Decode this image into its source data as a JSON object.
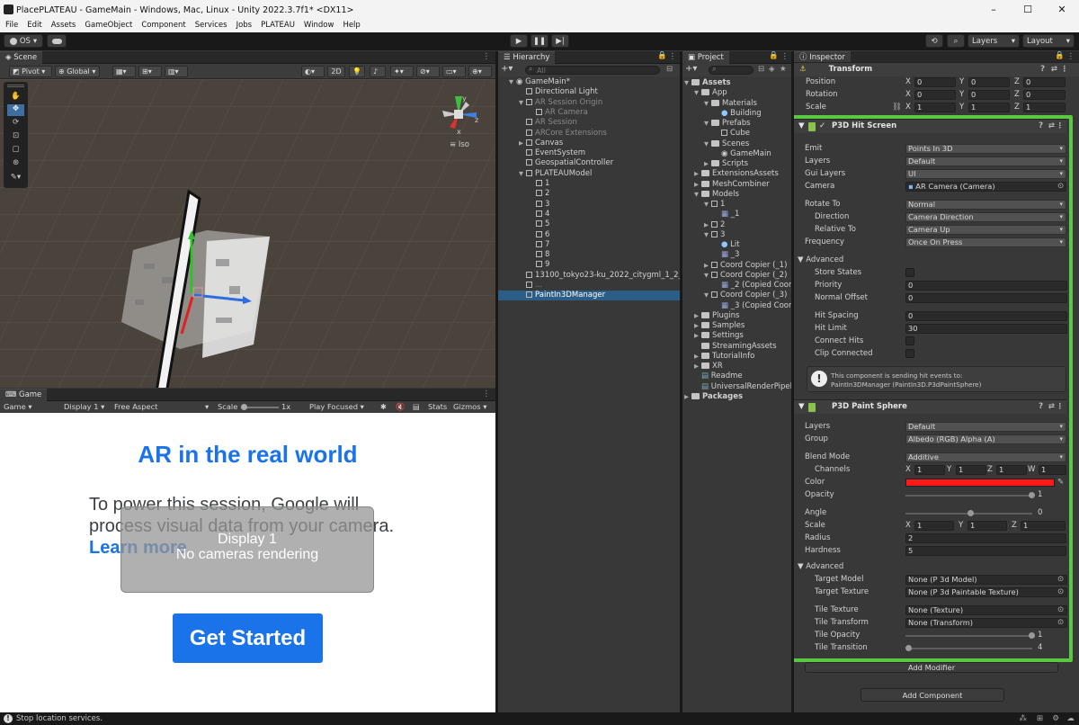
{
  "window": {
    "title": "PlacePLATEAU - GameMain - Windows, Mac, Linux - Unity 2022.3.7f1* <DX11>",
    "controls": [
      "–",
      "☐",
      "✕"
    ]
  },
  "menu": [
    "File",
    "Edit",
    "Assets",
    "GameObject",
    "Component",
    "Services",
    "Jobs",
    "PLATEAU",
    "Window",
    "Help"
  ],
  "toolbar": {
    "account": "OS",
    "layers": "Layers",
    "layout": "Layout"
  },
  "scene": {
    "tab": "Scene",
    "pivot": "Pivot",
    "global": "Global",
    "mode2d": "2D",
    "iso": "Iso",
    "gizmo_axes": {
      "x": "x",
      "y": "y",
      "z": "z"
    }
  },
  "game": {
    "tab": "Game",
    "view": "Game",
    "display": "Display 1",
    "aspect": "Free Aspect",
    "scale_label": "Scale",
    "scale_value": "1x",
    "play_focused": "Play Focused",
    "stats": "Stats",
    "gizmos": "Gizmos",
    "heading": "AR in the real world",
    "body": "To power this session, Google will process visual data from your camera.",
    "learn_more": "Learn more",
    "overlay_line1": "Display 1",
    "overlay_line2": "No cameras rendering",
    "button": "Get Started"
  },
  "hierarchy": {
    "tab": "Hierarchy",
    "search_placeholder": "All",
    "items": [
      {
        "label": "GameMain*",
        "indent": 0,
        "kind": "scene",
        "muted": false,
        "arrow": "▼"
      },
      {
        "label": "Directional Light",
        "indent": 1,
        "kind": "cube",
        "muted": false,
        "arrow": ""
      },
      {
        "label": "AR Session Origin",
        "indent": 1,
        "kind": "cube",
        "muted": true,
        "arrow": "▼"
      },
      {
        "label": "AR Camera",
        "indent": 2,
        "kind": "cube",
        "muted": true,
        "arrow": ""
      },
      {
        "label": "AR Session",
        "indent": 1,
        "kind": "cube",
        "muted": true,
        "arrow": ""
      },
      {
        "label": "ARCore Extensions",
        "indent": 1,
        "kind": "cube",
        "muted": true,
        "arrow": ""
      },
      {
        "label": "Canvas",
        "indent": 1,
        "kind": "cube",
        "muted": false,
        "arrow": "▶"
      },
      {
        "label": "EventSystem",
        "indent": 1,
        "kind": "cube",
        "muted": false,
        "arrow": ""
      },
      {
        "label": "GeospatialController",
        "indent": 1,
        "kind": "cube",
        "muted": false,
        "arrow": ""
      },
      {
        "label": "PLATEAUModel",
        "indent": 1,
        "kind": "cube",
        "muted": false,
        "arrow": "▼"
      },
      {
        "label": "1",
        "indent": 2,
        "kind": "cube",
        "muted": false,
        "arrow": ""
      },
      {
        "label": "2",
        "indent": 2,
        "kind": "cube",
        "muted": false,
        "arrow": ""
      },
      {
        "label": "3",
        "indent": 2,
        "kind": "cube",
        "muted": false,
        "arrow": ""
      },
      {
        "label": "4",
        "indent": 2,
        "kind": "cube",
        "muted": false,
        "arrow": ""
      },
      {
        "label": "5",
        "indent": 2,
        "kind": "cube",
        "muted": false,
        "arrow": ""
      },
      {
        "label": "6",
        "indent": 2,
        "kind": "cube",
        "muted": false,
        "arrow": ""
      },
      {
        "label": "7",
        "indent": 2,
        "kind": "cube",
        "muted": false,
        "arrow": ""
      },
      {
        "label": "8",
        "indent": 2,
        "kind": "cube",
        "muted": false,
        "arrow": ""
      },
      {
        "label": "9",
        "indent": 2,
        "kind": "cube",
        "muted": false,
        "arrow": ""
      },
      {
        "label": "13100_tokyo23-ku_2022_citygml_1_2_...",
        "indent": 1,
        "kind": "cube",
        "muted": false,
        "arrow": ""
      },
      {
        "label": "...",
        "indent": 1,
        "kind": "cube",
        "muted": true,
        "arrow": ""
      },
      {
        "label": "PaintIn3DManager",
        "indent": 1,
        "kind": "cube",
        "muted": false,
        "arrow": "",
        "selected": true
      }
    ]
  },
  "project": {
    "tab": "Project",
    "items": [
      {
        "label": "Assets",
        "indent": 0,
        "kind": "folder",
        "arrow": "▼",
        "bold": true
      },
      {
        "label": "App",
        "indent": 1,
        "kind": "folder",
        "arrow": "▼"
      },
      {
        "label": "Materials",
        "indent": 2,
        "kind": "folder",
        "arrow": "▼"
      },
      {
        "label": "Building",
        "indent": 3,
        "kind": "material",
        "arrow": ""
      },
      {
        "label": "Prefabs",
        "indent": 2,
        "kind": "folder",
        "arrow": "▼"
      },
      {
        "label": "Cube",
        "indent": 3,
        "kind": "cube",
        "arrow": ""
      },
      {
        "label": "Scenes",
        "indent": 2,
        "kind": "folder",
        "arrow": "▼"
      },
      {
        "label": "GameMain",
        "indent": 3,
        "kind": "scene",
        "arrow": ""
      },
      {
        "label": "Scripts",
        "indent": 2,
        "kind": "folder",
        "arrow": "▶"
      },
      {
        "label": "ExtensionsAssets",
        "indent": 1,
        "kind": "folder",
        "arrow": "▶"
      },
      {
        "label": "MeshCombiner",
        "indent": 1,
        "kind": "folder",
        "arrow": "▶"
      },
      {
        "label": "Models",
        "indent": 1,
        "kind": "folder",
        "arrow": "▼"
      },
      {
        "label": "1",
        "indent": 2,
        "kind": "cube",
        "arrow": "▼"
      },
      {
        "label": "_1",
        "indent": 3,
        "kind": "mesh",
        "arrow": ""
      },
      {
        "label": "2",
        "indent": 2,
        "kind": "cube",
        "arrow": "▶"
      },
      {
        "label": "3",
        "indent": 2,
        "kind": "cube",
        "arrow": "▼"
      },
      {
        "label": "Lit",
        "indent": 3,
        "kind": "material",
        "arrow": ""
      },
      {
        "label": "_3",
        "indent": 3,
        "kind": "mesh",
        "arrow": ""
      },
      {
        "label": "Coord Copier (_1)",
        "indent": 2,
        "kind": "cube",
        "arrow": "▶"
      },
      {
        "label": "Coord Copier (_2)",
        "indent": 2,
        "kind": "cube",
        "arrow": "▼"
      },
      {
        "label": "_2 (Copied Coor...",
        "indent": 3,
        "kind": "mesh",
        "arrow": ""
      },
      {
        "label": "Coord Copier (_3)",
        "indent": 2,
        "kind": "cube",
        "arrow": "▼"
      },
      {
        "label": "_3 (Copied Coor...",
        "indent": 3,
        "kind": "mesh",
        "arrow": ""
      },
      {
        "label": "Plugins",
        "indent": 1,
        "kind": "folder",
        "arrow": "▶"
      },
      {
        "label": "Samples",
        "indent": 1,
        "kind": "folder",
        "arrow": "▶"
      },
      {
        "label": "Settings",
        "indent": 1,
        "kind": "folder",
        "arrow": "▶"
      },
      {
        "label": "StreamingAssets",
        "indent": 1,
        "kind": "folder",
        "arrow": ""
      },
      {
        "label": "TutorialInfo",
        "indent": 1,
        "kind": "folder",
        "arrow": "▶"
      },
      {
        "label": "XR",
        "indent": 1,
        "kind": "folder",
        "arrow": "▶"
      },
      {
        "label": "Readme",
        "indent": 1,
        "kind": "doc",
        "arrow": ""
      },
      {
        "label": "UniversalRenderPipeline...",
        "indent": 1,
        "kind": "doc",
        "arrow": ""
      },
      {
        "label": "Packages",
        "indent": 0,
        "kind": "folder",
        "arrow": "▶",
        "bold": true
      }
    ]
  },
  "inspector": {
    "tab": "Inspector",
    "transform": {
      "title": "Transform",
      "rows": [
        {
          "label": "Position",
          "x": "0",
          "y": "0",
          "z": "0"
        },
        {
          "label": "Rotation",
          "x": "0",
          "y": "0",
          "z": "0"
        },
        {
          "label": "Scale",
          "x": "1",
          "y": "1",
          "z": "1"
        }
      ]
    },
    "hit_screen": {
      "title": "P3D Hit Screen",
      "emit": {
        "label": "Emit",
        "value": "Points In 3D"
      },
      "layers": {
        "label": "Layers",
        "value": "Default"
      },
      "gui_layers": {
        "label": "Gui Layers",
        "value": "UI"
      },
      "camera": {
        "label": "Camera",
        "value": "AR Camera (Camera)"
      },
      "rotate_to": {
        "label": "Rotate To",
        "value": "Normal"
      },
      "direction": {
        "label": "Direction",
        "value": "Camera Direction"
      },
      "relative_to": {
        "label": "Relative To",
        "value": "Camera Up"
      },
      "frequency": {
        "label": "Frequency",
        "value": "Once On Press"
      },
      "advanced": "Advanced",
      "store_states": "Store States",
      "priority": {
        "label": "Priority",
        "value": "0"
      },
      "normal_offset": {
        "label": "Normal Offset",
        "value": "0"
      },
      "hit_spacing": {
        "label": "Hit Spacing",
        "value": "0"
      },
      "hit_limit": {
        "label": "Hit Limit",
        "value": "30"
      },
      "connect_hits": "Connect Hits",
      "clip_connected": "Clip Connected",
      "info_line1": "This component is sending hit events to:",
      "info_line2": "PaintIn3DManager (PaintIn3D.P3dPaintSphere)"
    },
    "paint_sphere": {
      "title": "P3D Paint Sphere",
      "layers": {
        "label": "Layers",
        "value": "Default"
      },
      "group": {
        "label": "Group",
        "value": "Albedo (RGB) Alpha (A)"
      },
      "blend_mode": {
        "label": "Blend Mode",
        "value": "Additive"
      },
      "channels": {
        "label": "Channels",
        "x": "1",
        "y": "1",
        "z": "1",
        "w": "1"
      },
      "color": {
        "label": "Color",
        "value": "#ff1a1a"
      },
      "opacity": {
        "label": "Opacity",
        "value": "1",
        "fraction": 1.0
      },
      "angle": {
        "label": "Angle",
        "value": "0",
        "fraction": 0.5
      },
      "scale": {
        "label": "Scale",
        "x": "1",
        "y": "1",
        "z": "1"
      },
      "radius": {
        "label": "Radius",
        "value": "2"
      },
      "hardness": {
        "label": "Hardness",
        "value": "5"
      },
      "advanced": "Advanced",
      "target_model": {
        "label": "Target Model",
        "value": "None (P 3d Model)"
      },
      "target_texture": {
        "label": "Target Texture",
        "value": "None (P 3d Paintable Texture)"
      },
      "tile_texture": {
        "label": "Tile Texture",
        "value": "None (Texture)"
      },
      "tile_transform": {
        "label": "Tile Transform",
        "value": "None (Transform)"
      },
      "tile_opacity": {
        "label": "Tile Opacity",
        "value": "1",
        "fraction": 1.0
      },
      "tile_transition": {
        "label": "Tile Transition",
        "value": "4",
        "fraction": 0.0
      }
    },
    "add_modifier": "Add Modifier",
    "add_component": "Add Component"
  },
  "status": {
    "text": "Stop location services."
  },
  "colors": {
    "highlight": "#5bc93f",
    "selection": "#2c5d87",
    "game_blue": "#1a73e8"
  }
}
